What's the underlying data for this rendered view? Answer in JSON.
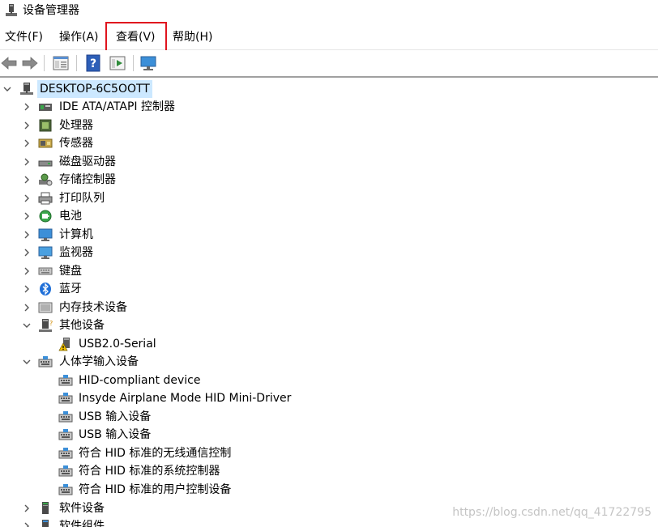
{
  "window": {
    "title": "设备管理器"
  },
  "menu": [
    {
      "id": "file",
      "label": "文件(F)"
    },
    {
      "id": "action",
      "label": "操作(A)"
    },
    {
      "id": "view",
      "label": "查看(V)"
    },
    {
      "id": "help",
      "label": "帮助(H)"
    }
  ],
  "toolbar": [
    "back-arrow-icon",
    "forward-arrow-icon",
    "properties-icon",
    "help-icon",
    "run-icon",
    "monitor-icon"
  ],
  "tree": {
    "root": {
      "label": "DESKTOP-6C5OOTT",
      "icon": "computer-tower-icon",
      "expanded": true
    },
    "categories": [
      {
        "label": "IDE ATA/ATAPI 控制器",
        "icon": "ide-controller-icon",
        "expanded": false
      },
      {
        "label": "处理器",
        "icon": "cpu-icon",
        "expanded": false
      },
      {
        "label": "传感器",
        "icon": "sensor-icon",
        "expanded": false
      },
      {
        "label": "磁盘驱动器",
        "icon": "disk-drive-icon",
        "expanded": false
      },
      {
        "label": "存储控制器",
        "icon": "storage-controller-icon",
        "expanded": false
      },
      {
        "label": "打印队列",
        "icon": "printer-icon",
        "expanded": false
      },
      {
        "label": "电池",
        "icon": "battery-icon",
        "expanded": false
      },
      {
        "label": "计算机",
        "icon": "computer-icon",
        "expanded": false
      },
      {
        "label": "监视器",
        "icon": "monitor-icon",
        "expanded": false
      },
      {
        "label": "键盘",
        "icon": "keyboard-icon",
        "expanded": false
      },
      {
        "label": "蓝牙",
        "icon": "bluetooth-icon",
        "expanded": false
      },
      {
        "label": "内存技术设备",
        "icon": "memory-device-icon",
        "expanded": false
      },
      {
        "label": "其他设备",
        "icon": "other-devices-icon",
        "expanded": true,
        "children": [
          {
            "label": "USB2.0-Serial",
            "icon": "warning-device-icon"
          }
        ]
      },
      {
        "label": "人体学输入设备",
        "icon": "hid-icon",
        "expanded": true,
        "children": [
          {
            "label": "HID-compliant device",
            "icon": "hid-icon"
          },
          {
            "label": "Insyde Airplane Mode HID Mini-Driver",
            "icon": "hid-icon"
          },
          {
            "label": "USB 输入设备",
            "icon": "hid-icon"
          },
          {
            "label": "USB 输入设备",
            "icon": "hid-icon"
          },
          {
            "label": "符合 HID 标准的无线通信控制",
            "icon": "hid-icon"
          },
          {
            "label": "符合 HID 标准的系统控制器",
            "icon": "hid-icon"
          },
          {
            "label": "符合 HID 标准的用户控制设备",
            "icon": "hid-icon"
          }
        ]
      },
      {
        "label": "软件设备",
        "icon": "software-device-icon",
        "expanded": false
      },
      {
        "label": "软件组件",
        "icon": "software-component-icon",
        "expanded": false
      }
    ]
  },
  "watermark": "https://blog.csdn.net/qq_41722795",
  "colors": {
    "selection": "#cce8ff",
    "highlight_box": "#e0141e"
  }
}
